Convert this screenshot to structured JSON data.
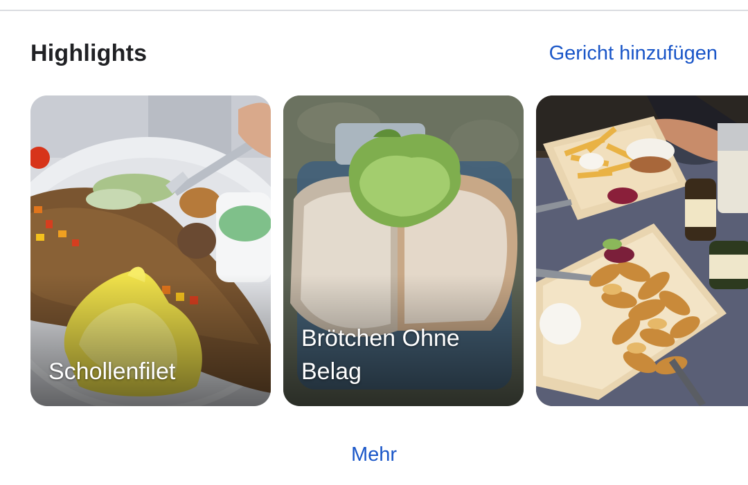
{
  "section": {
    "title": "Highlights",
    "add_dish_label": "Gericht hinzufügen"
  },
  "dishes": [
    {
      "name": "Schollenfilet",
      "photo": "fried-plaice-fillet-photo"
    },
    {
      "name": "Brötchen Ohne Belag",
      "photo": "bread-roll-lettuce-photo"
    },
    {
      "name": "",
      "photo": "fries-and-wedges-platter-photo"
    }
  ],
  "more_label": "Mehr",
  "colors": {
    "link": "#1a56c8",
    "title": "#202124",
    "divider": "#dadce0"
  }
}
